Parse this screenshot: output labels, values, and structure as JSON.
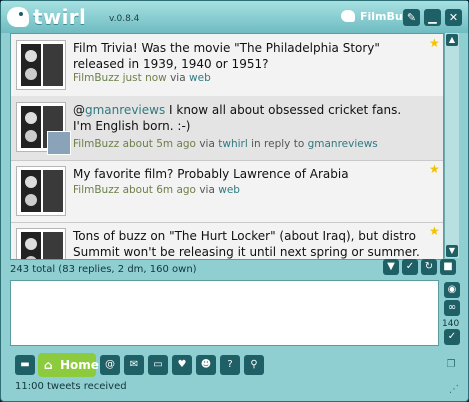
{
  "app": {
    "name": "twirl",
    "version": "v.0.8.4",
    "account": "FilmBuzz"
  },
  "window_buttons": [
    {
      "icon": "wrench-icon",
      "glyph": "✎"
    },
    {
      "icon": "minimize-icon",
      "glyph": "▁"
    },
    {
      "icon": "close-icon",
      "glyph": "✕"
    }
  ],
  "tweets": [
    {
      "text": "Film Trivia! Was the movie \"The Philadelphia Story\" released in 1939, 1940 or 1951?",
      "user": "FilmBuzz",
      "time": "just now",
      "via": "via",
      "source": "web",
      "reply_to": "",
      "starred": true
    },
    {
      "text_prefix": "@",
      "mention": "gmanreviews",
      "text": " I know all about obsessed cricket fans. I'm English born. :-)",
      "user": "FilmBuzz",
      "time": "about 5m ago",
      "via": "via",
      "source": "twhirl",
      "reply_text": "in reply to",
      "reply_to": "gmanreviews",
      "starred": false
    },
    {
      "text": "My favorite film? Probably Lawrence of Arabia",
      "user": "FilmBuzz",
      "time": "about 6m ago",
      "via": "via",
      "source": "web",
      "reply_to": "",
      "starred": true
    },
    {
      "text": "Tons of buzz on \"The Hurt Locker\" (about Iraq), but distro Summit won't be releasing it until next spring or summer. Quite a",
      "user": "",
      "time": "",
      "via": "",
      "source": "",
      "reply_to": "",
      "starred": true
    }
  ],
  "status": {
    "summary": "243 total (83 replies, 2 dm, 160 own)"
  },
  "compose": {
    "value": "",
    "count": "140"
  },
  "bottom_nav": {
    "home_label": "Home"
  },
  "footer": {
    "text": "11:00 tweets received"
  }
}
